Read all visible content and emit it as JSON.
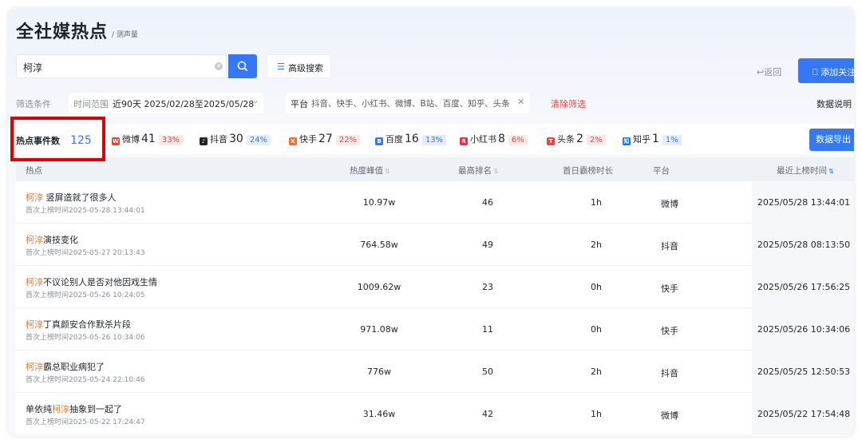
{
  "page": {
    "title": "全社媒热点",
    "subtitle": "/ 测声量"
  },
  "search": {
    "value": "柯淳",
    "advanced_label": "高级搜索"
  },
  "actions": {
    "back_label": "返回",
    "follow_label": "添加关注",
    "export_label": "数据导出",
    "data_desc_label": "数据说明"
  },
  "filters": {
    "label": "筛选条件",
    "time_label": "时间范围",
    "time_value": "近90天 2025/02/28至2025/05/28",
    "platform_label": "平台",
    "platform_value": "抖音、快手、小红书、微博、B站、百度、知乎、头条",
    "clear_label": "清除筛选"
  },
  "stats": {
    "total_label": "热点事件数",
    "total_value": "125",
    "platforms": [
      {
        "name": "微博",
        "count": "41",
        "pct": "33%",
        "tone": "red",
        "color": "#e6432f",
        "icon": "W"
      },
      {
        "name": "抖音",
        "count": "30",
        "pct": "24%",
        "tone": "blue",
        "color": "#1f2329",
        "icon": "♪"
      },
      {
        "name": "快手",
        "count": "27",
        "pct": "22%",
        "tone": "red",
        "color": "#ff6a2a",
        "icon": "K"
      },
      {
        "name": "百度",
        "count": "16",
        "pct": "13%",
        "tone": "blue",
        "color": "#3478f6",
        "icon": "B"
      },
      {
        "name": "小红书",
        "count": "8",
        "pct": "6%",
        "tone": "red",
        "color": "#ff2442",
        "icon": "R"
      },
      {
        "name": "头条",
        "count": "2",
        "pct": "2%",
        "tone": "red",
        "color": "#f04142",
        "icon": "T"
      },
      {
        "name": "知乎",
        "count": "1",
        "pct": "1%",
        "tone": "blue",
        "color": "#1772f6",
        "icon": "知"
      }
    ]
  },
  "table": {
    "headers": {
      "hot": "热点",
      "peak": "热度峰值",
      "rank": "最高排名",
      "duration": "首日霸榜时长",
      "platform": "平台",
      "recent": "最近上榜时间"
    },
    "first_listed_prefix": "首次上榜时间",
    "rows": [
      {
        "pre": "",
        "kw": "柯淳",
        "post": " 竖屏造就了很多人",
        "first": "2025-05-28 13:44:01",
        "peak": "10.97w",
        "rank": "46",
        "duration": "1h",
        "platform": "微博",
        "recent": "2025/05/28 13:44:01"
      },
      {
        "pre": "",
        "kw": "柯淳",
        "post": "演技变化",
        "first": "2025-05-27 20:13:43",
        "peak": "764.58w",
        "rank": "49",
        "duration": "2h",
        "platform": "抖音",
        "recent": "2025/05/28 08:13:50"
      },
      {
        "pre": "",
        "kw": "柯淳",
        "post": "不议论别人是否对他因戏生情",
        "first": "2025-05-26 10:24:05",
        "peak": "1009.62w",
        "rank": "23",
        "duration": "0h",
        "platform": "快手",
        "recent": "2025/05/26 17:56:25"
      },
      {
        "pre": "",
        "kw": "柯淳",
        "post": "丁真颜安合作默杀片段",
        "first": "2025-05-26 10:34:06",
        "peak": "971.08w",
        "rank": "11",
        "duration": "0h",
        "platform": "快手",
        "recent": "2025/05/26 10:34:06"
      },
      {
        "pre": "",
        "kw": "柯淳",
        "post": "霸总职业病犯了",
        "first": "2025-05-24 22:10:46",
        "peak": "776w",
        "rank": "50",
        "duration": "2h",
        "platform": "抖音",
        "recent": "2025/05/25 12:50:53"
      },
      {
        "pre": "单依纯",
        "kw": "柯淳",
        "post": "抽象到一起了",
        "first": "2025-05-22 17:24:47",
        "peak": "31.46w",
        "rank": "42",
        "duration": "1h",
        "platform": "微博",
        "recent": "2025/05/22 17:54:48"
      }
    ]
  }
}
